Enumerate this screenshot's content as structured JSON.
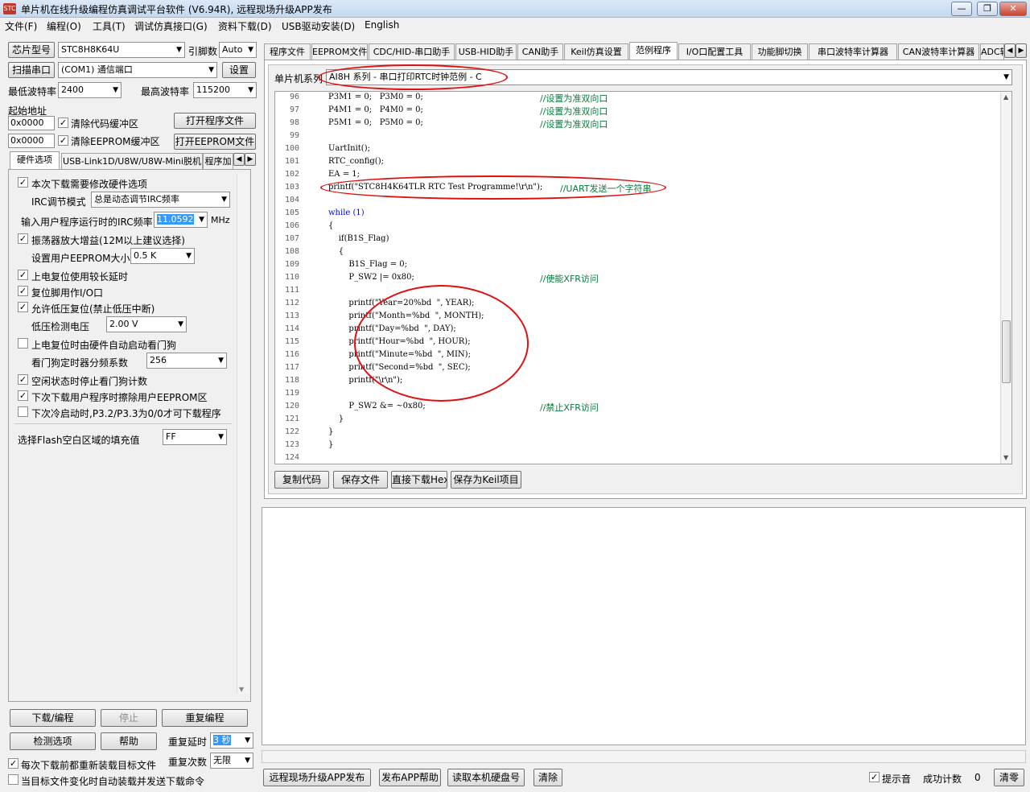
{
  "window": {
    "title": "单片机在线升级编程仿真调试平台软件 (V6.94R), 远程现场升级APP发布",
    "app_icon": "chip-app-icon"
  },
  "menu": [
    "文件(F)",
    "编程(O)",
    "工具(T)",
    "调试仿真接口(G)",
    "资料下载(D)",
    "USB驱动安装(D)",
    "English"
  ],
  "left": {
    "chip_btn": "芯片型号",
    "chip_value": "STC8H8K64U",
    "pin_label": "引脚数",
    "pin_value": "Auto",
    "scan_btn": "扫描串口",
    "port_value": "(COM1) 通信端口",
    "settings_btn": "设置",
    "min_baud_label": "最低波特率",
    "min_baud": "2400",
    "max_baud_label": "最高波特率",
    "max_baud": "115200",
    "start_addr_label": "起始地址",
    "addr1": "0x0000",
    "clear_code": "清除代码缓冲区",
    "open_prog": "打开程序文件",
    "addr2": "0x0000",
    "clear_eeprom": "清除EEPROM缓冲区",
    "open_eeprom": "打开EEPROM文件",
    "tabs": [
      "硬件选项",
      "USB-Link1D/U8W/U8W-Mini脱机",
      "程序加"
    ],
    "hw": {
      "opt_modify": "本次下载需要修改硬件选项",
      "irc_mode_label": "IRC调节模式",
      "irc_mode": "总是动态调节IRC频率",
      "irc_freq_label": "输入用户程序运行时的IRC频率",
      "irc_freq": "11.0592",
      "mhz": "MHz",
      "osc_gain": "振荡器放大增益(12M以上建议选择)",
      "eeprom_size_label": "设置用户EEPROM大小",
      "eeprom_size": "0.5 K",
      "power_delay": "上电复位使用较长延时",
      "reset_io": "复位脚用作I/O口",
      "lvd_reset": "允许低压复位(禁止低压中断)",
      "lvd_label": "低压检测电压",
      "lvd_value": "2.00 V",
      "wdt_hw": "上电复位时由硬件自动启动看门狗",
      "wdt_div_label": "看门狗定时器分频系数",
      "wdt_div": "256",
      "idle_wdt": "空闲状态时停止看门狗计数",
      "erase_eeprom": "下次下载用户程序时擦除用户EEPROM区",
      "cold_boot": "下次冷启动时,P3.2/P3.3为0/0才可下载程序",
      "flash_fill_label": "选择Flash空白区域的填充值",
      "flash_fill": "FF"
    },
    "download_btn": "下载/编程",
    "stop_btn": "停止",
    "reprogram_btn": "重复编程",
    "check_btn": "检测选项",
    "help_btn": "帮助",
    "repeat_delay_label": "重复延时",
    "repeat_delay": "3 秒",
    "repeat_count_label": "重复次数",
    "repeat_count": "无限",
    "reload_each": "每次下载前都重新装载目标文件",
    "auto_reload": "当目标文件变化时自动装载并发送下载命令"
  },
  "tabs": [
    "程序文件",
    "EEPROM文件",
    "CDC/HID-串口助手",
    "USB-HID助手",
    "CAN助手",
    "Keil仿真设置",
    "范例程序",
    "I/O口配置工具",
    "功能脚切换",
    "串口波特率计算器",
    "CAN波特率计算器",
    "ADC转"
  ],
  "example": {
    "series_label": "单片机系列",
    "series_value": "AI8H 系列 - 串口打印RTC时钟范例 - C",
    "lines": [
      {
        "n": "96",
        "code": "P3M1 = 0;   P3M0 = 0;",
        "cmt": "//设置为准双向口"
      },
      {
        "n": "97",
        "code": "P4M1 = 0;   P4M0 = 0;",
        "cmt": "//设置为准双向口"
      },
      {
        "n": "98",
        "code": "P5M1 = 0;   P5M0 = 0;",
        "cmt": "//设置为准双向口"
      },
      {
        "n": "99",
        "code": "",
        "cmt": ""
      },
      {
        "n": "100",
        "code": "UartInit();",
        "cmt": ""
      },
      {
        "n": "101",
        "code": "RTC_config();",
        "cmt": ""
      },
      {
        "n": "102",
        "code": "EA = 1;",
        "cmt": ""
      },
      {
        "n": "103",
        "code": "printf(\"STC8H4K64TLR RTC Test Programme!\\r\\n\"); ",
        "cmt": "//UART发送一个字符串"
      },
      {
        "n": "104",
        "code": "",
        "cmt": ""
      },
      {
        "n": "105",
        "code": "while (1)",
        "cmt": ""
      },
      {
        "n": "106",
        "code": "{",
        "cmt": ""
      },
      {
        "n": "107",
        "code": "    if(B1S_Flag)",
        "cmt": ""
      },
      {
        "n": "108",
        "code": "    {",
        "cmt": ""
      },
      {
        "n": "109",
        "code": "        B1S_Flag = 0;",
        "cmt": ""
      },
      {
        "n": "110",
        "code": "        P_SW2 |= 0x80;",
        "cmt": "//使能XFR访问"
      },
      {
        "n": "111",
        "code": "",
        "cmt": ""
      },
      {
        "n": "112",
        "code": "        printf(\"Year=20%bd  \", YEAR);",
        "cmt": ""
      },
      {
        "n": "113",
        "code": "        printf(\"Month=%bd  \", MONTH);",
        "cmt": ""
      },
      {
        "n": "114",
        "code": "        printf(\"Day=%bd  \", DAY);",
        "cmt": ""
      },
      {
        "n": "115",
        "code": "        printf(\"Hour=%bd  \", HOUR);",
        "cmt": ""
      },
      {
        "n": "116",
        "code": "        printf(\"Minute=%bd  \", MIN);",
        "cmt": ""
      },
      {
        "n": "117",
        "code": "        printf(\"Second=%bd  \", SEC);",
        "cmt": ""
      },
      {
        "n": "118",
        "code": "        printf(\"\\r\\n\");",
        "cmt": ""
      },
      {
        "n": "119",
        "code": "",
        "cmt": ""
      },
      {
        "n": "120",
        "code": "        P_SW2 &= ~0x80;",
        "cmt": "//禁止XFR访问"
      },
      {
        "n": "121",
        "code": "    }",
        "cmt": ""
      },
      {
        "n": "122",
        "code": "}",
        "cmt": ""
      },
      {
        "n": "123",
        "code": "}",
        "cmt": ""
      },
      {
        "n": "124",
        "code": "",
        "cmt": ""
      }
    ],
    "copy_btn": "复制代码",
    "save_btn": "保存文件",
    "direct_btn": "直接下载Hex",
    "keil_btn": "保存为Keil项目"
  },
  "bottom": {
    "remote_btn": "远程现场升级APP发布",
    "help_btn": "发布APP帮助",
    "disk_btn": "读取本机硬盘号",
    "clear_btn": "清除",
    "beep": "提示音",
    "success_label": "成功计数",
    "success_count": "0",
    "reset_btn": "清零"
  },
  "colors": {
    "annotation": "#e01010",
    "comment": "#0a7a3c",
    "keyword": "#0000ff"
  }
}
